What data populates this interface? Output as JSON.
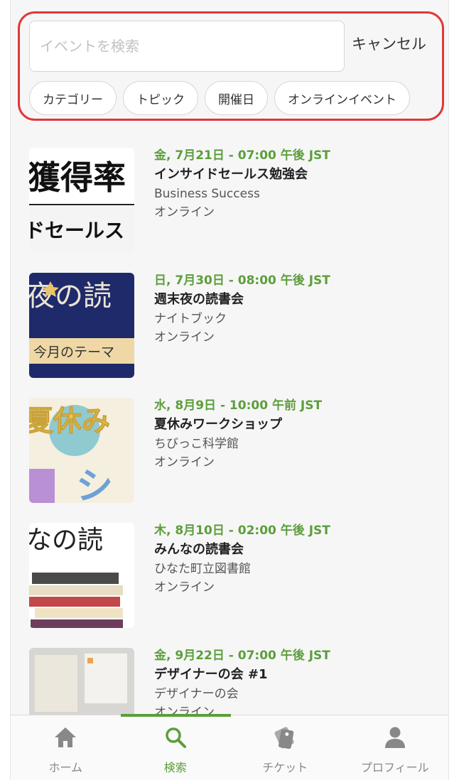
{
  "search": {
    "placeholder": "イベントを検索",
    "cancel_label": "キャンセル",
    "filters": [
      "カテゴリー",
      "トピック",
      "開催日",
      "オンラインイベント"
    ]
  },
  "events": [
    {
      "date": "金, 7月21日 - 07:00 午後 JST",
      "title": "インサイドセールス勉強会",
      "organizer": "Business Success",
      "location": "オンライン",
      "thumb_text": [
        "獲得率",
        "ドセールス"
      ]
    },
    {
      "date": "日, 7月30日 - 08:00 午後 JST",
      "title": "週末夜の読書会",
      "organizer": "ナイトブック",
      "location": "オンライン",
      "thumb_text": [
        "夜の読",
        "今月のテーマ"
      ]
    },
    {
      "date": "水, 8月9日 - 10:00 午前 JST",
      "title": "夏休みワークショップ",
      "organizer": "ちびっこ科学館",
      "location": "オンライン",
      "thumb_text": [
        "夏休み",
        "シ"
      ]
    },
    {
      "date": "木, 8月10日 - 02:00 午後 JST",
      "title": "みんなの読書会",
      "organizer": "ひなた町立図書館",
      "location": "オンライン",
      "thumb_text": [
        "なの読"
      ]
    },
    {
      "date": "金, 9月22日 - 07:00 午後 JST",
      "title": "デザイナーの会 #1",
      "organizer": "デザイナーの会",
      "location": "オンライン",
      "thumb_text": []
    }
  ],
  "tabs": [
    {
      "label": "ホーム",
      "icon": "home-icon"
    },
    {
      "label": "検索",
      "icon": "search-icon"
    },
    {
      "label": "チケット",
      "icon": "ticket-icon"
    },
    {
      "label": "プロフィール",
      "icon": "profile-icon"
    }
  ],
  "active_tab": "検索",
  "colors": {
    "accent": "#5c9e3b",
    "highlight_border": "#e0383a"
  }
}
